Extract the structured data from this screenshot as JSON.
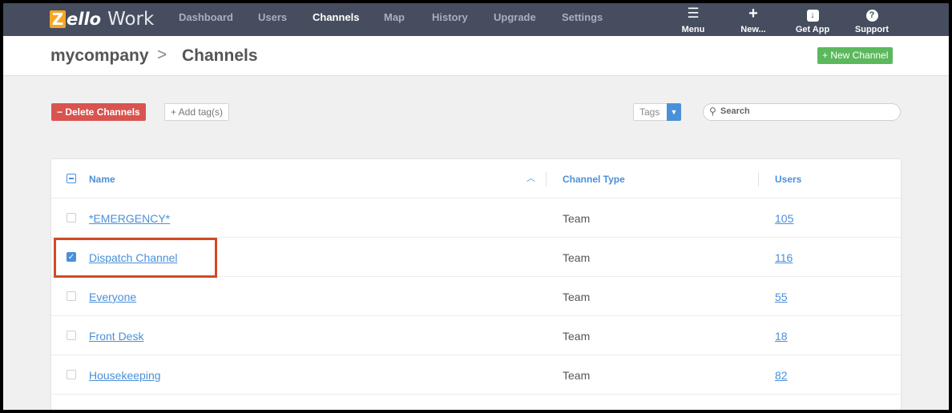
{
  "nav": {
    "logo_z": "Z",
    "logo_ello": "ello",
    "logo_work": "Work",
    "items": [
      {
        "label": "Dashboard"
      },
      {
        "label": "Users"
      },
      {
        "label": "Channels"
      },
      {
        "label": "Map"
      },
      {
        "label": "History"
      },
      {
        "label": "Upgrade"
      },
      {
        "label": "Settings"
      }
    ],
    "active": "Channels",
    "right": [
      {
        "label": "Menu",
        "icon": "menu-icon"
      },
      {
        "label": "New...",
        "icon": "plus-icon"
      },
      {
        "label": "Get App",
        "icon": "download-icon"
      },
      {
        "label": "Support",
        "icon": "help-icon"
      }
    ]
  },
  "header": {
    "company": "mycompany",
    "separator": ">",
    "page": "Channels",
    "new_channel": "+ New Channel"
  },
  "toolbar": {
    "delete": "− Delete Channels",
    "add_tag": "+ Add tag(s)",
    "tags_label": "Tags",
    "search_placeholder": "Search"
  },
  "table": {
    "columns": {
      "name": "Name",
      "type": "Channel Type",
      "users": "Users"
    },
    "rows": [
      {
        "name": "*EMERGENCY*",
        "type": "Team",
        "users": "105",
        "checked": false
      },
      {
        "name": "Dispatch Channel",
        "type": "Team",
        "users": "116",
        "checked": true
      },
      {
        "name": "Everyone",
        "type": "Team",
        "users": "55",
        "checked": false
      },
      {
        "name": "Front Desk",
        "type": "Team",
        "users": "18",
        "checked": false
      },
      {
        "name": "Housekeeping",
        "type": "Team",
        "users": "82",
        "checked": false
      }
    ]
  },
  "colors": {
    "nav_bg": "#454d5f",
    "accent": "#4a90d9",
    "danger": "#d9534f",
    "success": "#5cb85c",
    "highlight": "#d04a26"
  }
}
